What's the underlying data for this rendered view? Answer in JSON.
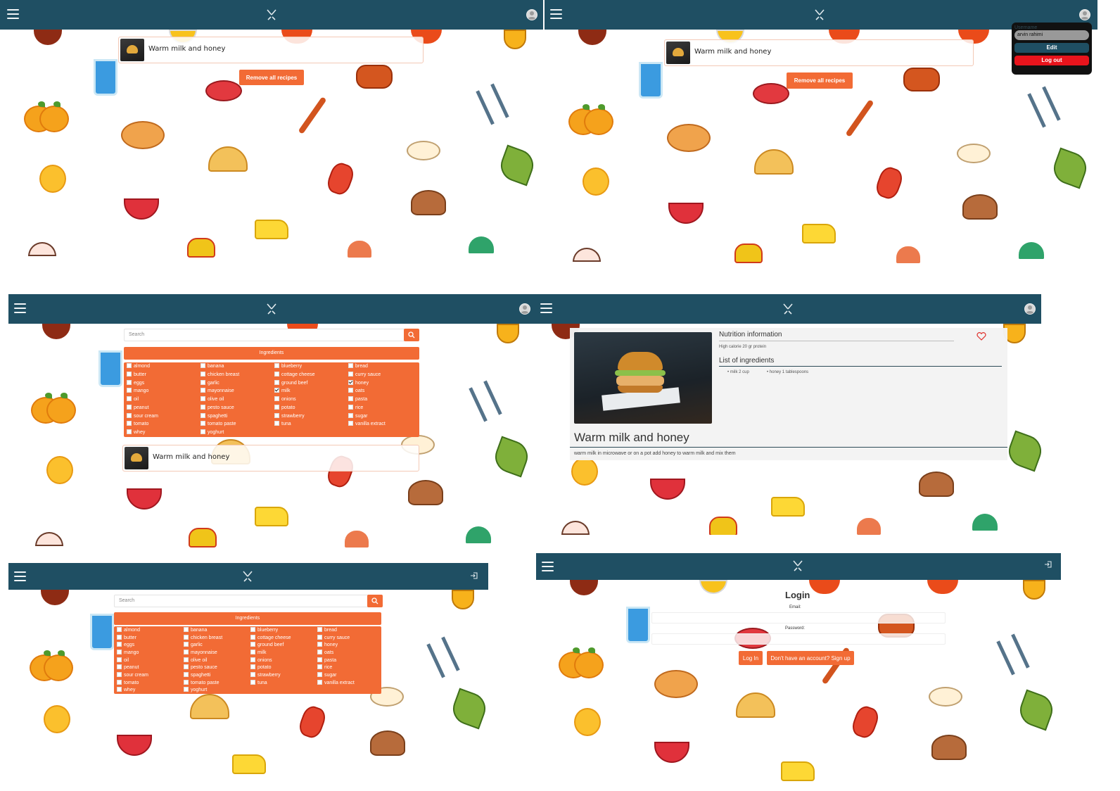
{
  "recipes_a": {
    "recipe_title": "Warm milk and honey",
    "remove_all_label": "Remove all recipes"
  },
  "recipes_b": {
    "recipe_title": "Warm milk and honey",
    "remove_all_label": "Remove all recipes",
    "user_menu": {
      "username_label": "Username",
      "username_value": "arvin rahimi",
      "edit_label": "Edit",
      "logout_label": "Log out",
      "colors": {
        "edit": "#1f4f63",
        "logout": "#e8141c",
        "bg": "#111111"
      }
    }
  },
  "search_checked": {
    "search_placeholder": "Search",
    "ingredients_header": "Ingredients",
    "ingredients": [
      {
        "label": "almond",
        "checked": false
      },
      {
        "label": "banana",
        "checked": false
      },
      {
        "label": "blueberry",
        "checked": false
      },
      {
        "label": "bread",
        "checked": false
      },
      {
        "label": "butter",
        "checked": false
      },
      {
        "label": "chicken breast",
        "checked": false
      },
      {
        "label": "cottage cheese",
        "checked": false
      },
      {
        "label": "curry sauce",
        "checked": false
      },
      {
        "label": "eggs",
        "checked": false
      },
      {
        "label": "garlic",
        "checked": false
      },
      {
        "label": "ground beef",
        "checked": false
      },
      {
        "label": "honey",
        "checked": true
      },
      {
        "label": "mango",
        "checked": false
      },
      {
        "label": "mayonnaise",
        "checked": false
      },
      {
        "label": "milk",
        "checked": true
      },
      {
        "label": "oats",
        "checked": false
      },
      {
        "label": "oil",
        "checked": false
      },
      {
        "label": "olive oil",
        "checked": false
      },
      {
        "label": "onions",
        "checked": false
      },
      {
        "label": "pasta",
        "checked": false
      },
      {
        "label": "peanut",
        "checked": false
      },
      {
        "label": "pesto sauce",
        "checked": false
      },
      {
        "label": "potato",
        "checked": false
      },
      {
        "label": "rice",
        "checked": false
      },
      {
        "label": "sour cream",
        "checked": false
      },
      {
        "label": "spaghetti",
        "checked": false
      },
      {
        "label": "strawberry",
        "checked": false
      },
      {
        "label": "sugar",
        "checked": false
      },
      {
        "label": "tomato",
        "checked": false
      },
      {
        "label": "tomato paste",
        "checked": false
      },
      {
        "label": "tuna",
        "checked": false
      },
      {
        "label": "vanilla extract",
        "checked": false
      },
      {
        "label": "whey",
        "checked": false
      },
      {
        "label": "yoghurt",
        "checked": false
      }
    ],
    "result_title": "Warm milk and honey"
  },
  "detail": {
    "nutrition_title": "Nutrition information",
    "nutrition_text": "High calorie 20 gr protein",
    "ingredients_title": "List of ingredients",
    "ingredients_list": [
      "milk 2 cup",
      "honey 1 tablespoons"
    ],
    "recipe_title": "Warm milk and honey",
    "description": "warm milk in microwave or on a pot add honey to warm milk and mix them"
  },
  "search_empty": {
    "search_placeholder": "Search",
    "ingredients_header": "Ingredients",
    "ingredients": [
      "almond",
      "banana",
      "blueberry",
      "bread",
      "butter",
      "chicken breast",
      "cottage cheese",
      "curry sauce",
      "eggs",
      "garlic",
      "ground beef",
      "honey",
      "mango",
      "mayonnaise",
      "milk",
      "oats",
      "oil",
      "olive oil",
      "onions",
      "pasta",
      "peanut",
      "pesto sauce",
      "potato",
      "rice",
      "sour cream",
      "spaghetti",
      "strawberry",
      "sugar",
      "tomato",
      "tomato paste",
      "tuna",
      "vanilla extract",
      "whey",
      "yoghurt"
    ]
  },
  "login": {
    "heading": "Login",
    "email_label": "Email:",
    "password_label": "Password:",
    "login_button": "Log In",
    "signup_button": "Don't have an account? Sign up"
  },
  "icons": {
    "menu": "hamburger-menu-icon",
    "logo": "fork-knife-logo-icon",
    "avatar": "user-avatar-icon",
    "login": "login-icon",
    "search": "search-icon",
    "heart": "heart-icon"
  },
  "colors": {
    "navbar": "#1f4f63",
    "accent": "#f26b35",
    "background": "#ffffff"
  }
}
